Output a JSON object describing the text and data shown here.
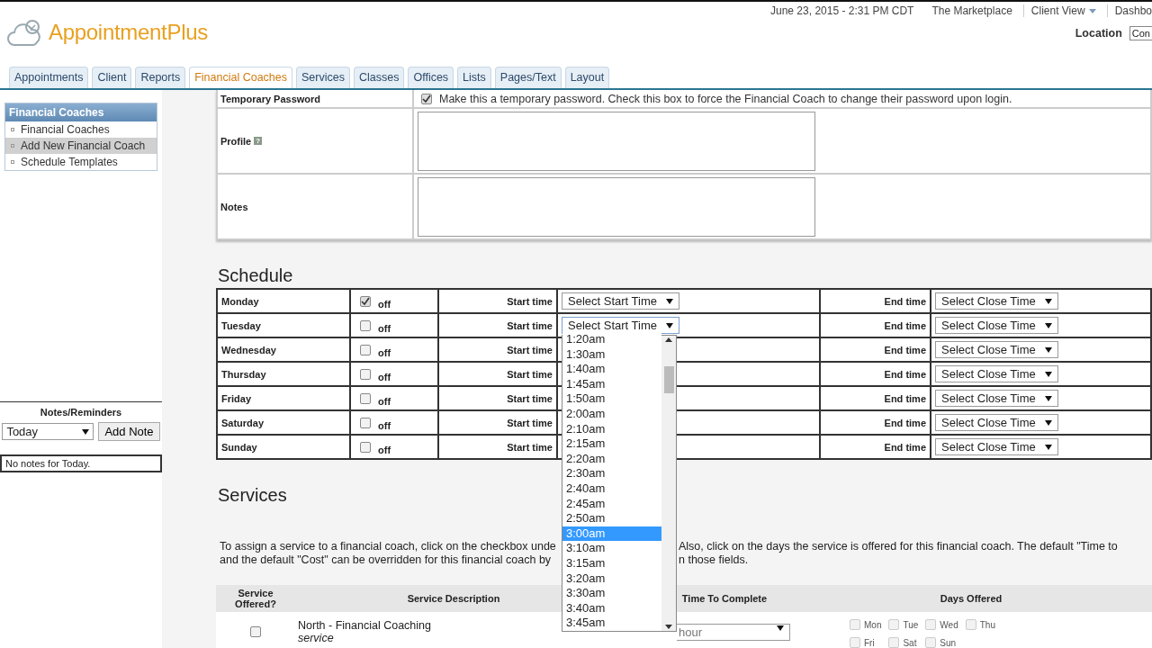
{
  "header": {
    "logo": "AppointmentPlus",
    "datetime": "June 23, 2015 - 2:31 PM CDT",
    "links": [
      {
        "label": "The Marketplace",
        "kind": "link"
      },
      {
        "label": "Client View",
        "kind": "menu"
      },
      {
        "label": "Dashbo",
        "kind": "link"
      }
    ],
    "location_label": "Location",
    "location_value": "Con"
  },
  "tabs": [
    {
      "label": "Appointments",
      "selected": false
    },
    {
      "label": "Client",
      "selected": false
    },
    {
      "label": "Reports",
      "selected": false
    },
    {
      "label": "Financial Coaches",
      "selected": true
    },
    {
      "label": "Services",
      "selected": false
    },
    {
      "label": "Classes",
      "selected": false
    },
    {
      "label": "Offices",
      "selected": false
    },
    {
      "label": "Lists",
      "selected": false
    },
    {
      "label": "Pages/Text",
      "selected": false
    },
    {
      "label": "Layout",
      "selected": false
    }
  ],
  "sidebar": {
    "title": "Financial Coaches",
    "items": [
      {
        "label": "Financial Coaches",
        "selected": false
      },
      {
        "label": "Add New Financial Coach",
        "selected": true
      },
      {
        "label": "Schedule Templates",
        "selected": false
      }
    ]
  },
  "notes": {
    "title": "Notes/Reminders",
    "period": "Today",
    "button": "Add Note",
    "message": "No notes for Today."
  },
  "form": {
    "rows": [
      {
        "kind": "checkbox",
        "label": "Temporary Password",
        "checked": true,
        "text": "Make this a temporary password. Check this box to force the Financial Coach to change their password upon login."
      },
      {
        "kind": "textarea",
        "label": "Profile",
        "help": "?"
      },
      {
        "kind": "textarea",
        "label": "Notes"
      }
    ]
  },
  "schedule": {
    "title": "Schedule",
    "days": [
      {
        "day": "Monday",
        "checked": true,
        "off": "off",
        "start_label": "Start time",
        "start": "Select Start Time",
        "end_label": "End time",
        "end": "Select Close Time",
        "open": false
      },
      {
        "day": "Tuesday",
        "checked": false,
        "off": "off",
        "start_label": "Start time",
        "start": "Select Start Time",
        "end_label": "End time",
        "end": "Select Close Time",
        "open": true
      },
      {
        "day": "Wednesday",
        "checked": false,
        "off": "off",
        "start_label": "Start time",
        "end_label": "End time",
        "end": "Select Close Time",
        "open": false
      },
      {
        "day": "Thursday",
        "checked": false,
        "off": "off",
        "start_label": "Start time",
        "end_label": "End time",
        "end": "Select Close Time",
        "open": false
      },
      {
        "day": "Friday",
        "checked": false,
        "off": "off",
        "start_label": "Start time",
        "end_label": "End time",
        "end": "Select Close Time",
        "open": false
      },
      {
        "day": "Saturday",
        "checked": false,
        "off": "off",
        "start_label": "Start time",
        "end_label": "End time",
        "end": "Select Close Time",
        "open": false
      },
      {
        "day": "Sunday",
        "checked": false,
        "off": "off",
        "start_label": "Start time",
        "end_label": "End time",
        "end": "Select Close Time",
        "open": false
      }
    ],
    "options": [
      {
        "label": "1:20am",
        "selected": false
      },
      {
        "label": "1:30am",
        "selected": false
      },
      {
        "label": "1:40am",
        "selected": false
      },
      {
        "label": "1:45am",
        "selected": false
      },
      {
        "label": "1:50am",
        "selected": false
      },
      {
        "label": "2:00am",
        "selected": false
      },
      {
        "label": "2:10am",
        "selected": false
      },
      {
        "label": "2:15am",
        "selected": false
      },
      {
        "label": "2:20am",
        "selected": false
      },
      {
        "label": "2:30am",
        "selected": false
      },
      {
        "label": "2:40am",
        "selected": false
      },
      {
        "label": "2:45am",
        "selected": false
      },
      {
        "label": "2:50am",
        "selected": false
      },
      {
        "label": "3:00am",
        "selected": true
      },
      {
        "label": "3:10am",
        "selected": false
      },
      {
        "label": "3:15am",
        "selected": false
      },
      {
        "label": "3:20am",
        "selected": false
      },
      {
        "label": "3:30am",
        "selected": false
      },
      {
        "label": "3:40am",
        "selected": false
      },
      {
        "label": "3:45am",
        "selected": false
      }
    ]
  },
  "services": {
    "title": "Services",
    "intro_left": [
      "To assign a service to a financial coach, click on the checkbox unde",
      "and the default \"Cost\" can be overridden for this financial coach by"
    ],
    "intro_right": [
      "Also, click on the days the service is offered for this financial coach. The default \"Time to",
      "n those fields."
    ],
    "columns": [
      "Service Offered?",
      "Service Description",
      "Time To Complete",
      "Days Offered"
    ],
    "rows": [
      {
        "offered": false,
        "name": "North - Financial Coaching",
        "type": "service",
        "time": "hour",
        "days": [
          {
            "label": "Mon",
            "checked": false
          },
          {
            "label": "Tue",
            "checked": false
          },
          {
            "label": "Wed",
            "checked": false
          },
          {
            "label": "Thu",
            "checked": false
          },
          {
            "label": "Fri",
            "checked": false
          },
          {
            "label": "Sat",
            "checked": false
          },
          {
            "label": "Sun",
            "checked": false
          }
        ]
      }
    ]
  }
}
